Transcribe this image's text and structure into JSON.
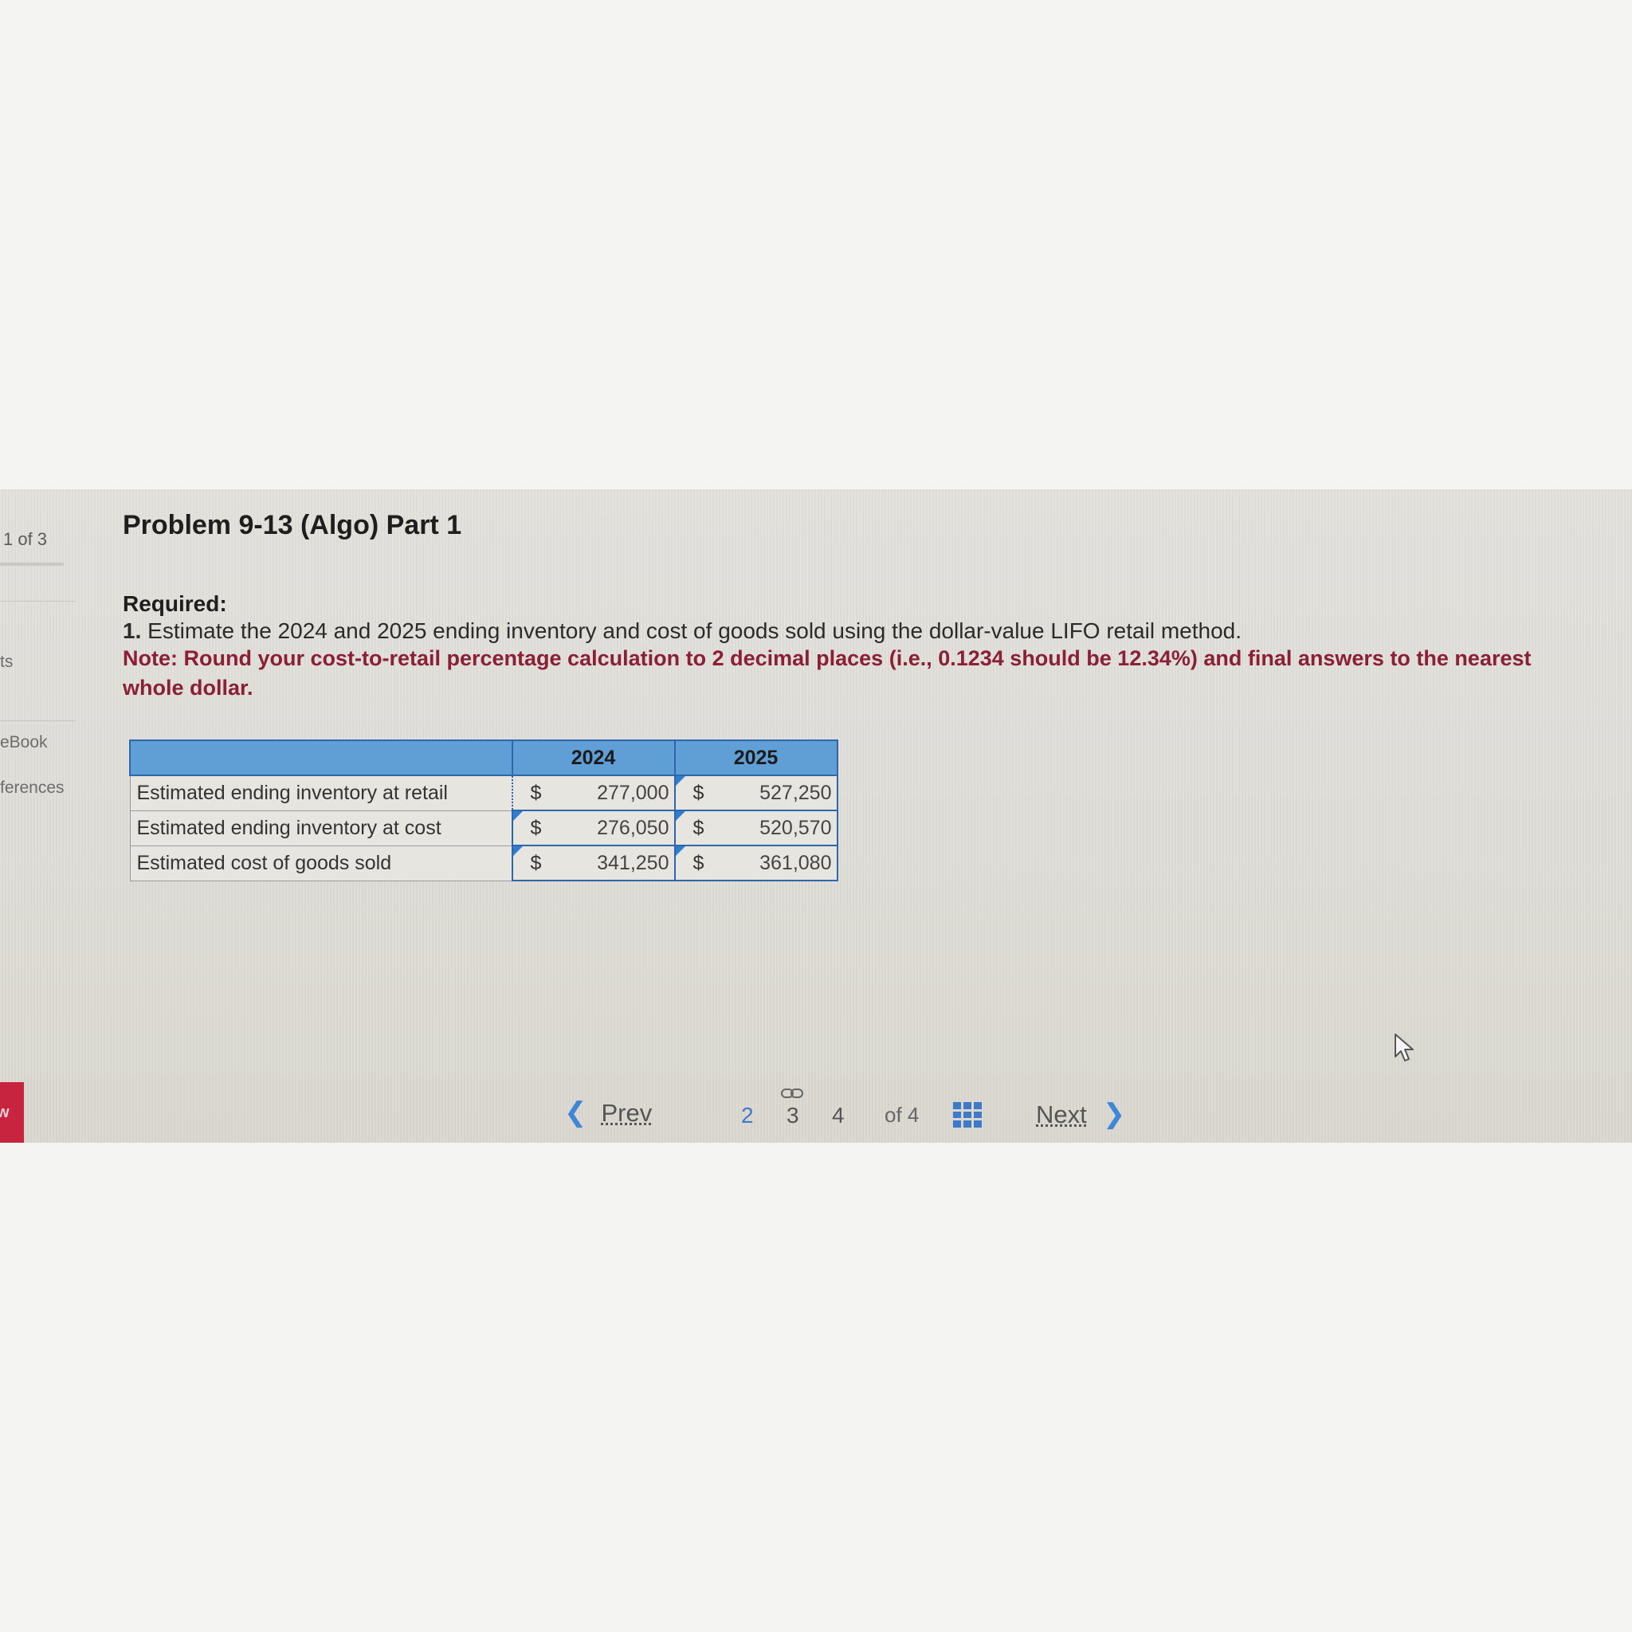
{
  "sidebar": {
    "counter": "1 of 3",
    "items": [
      {
        "label": "ts"
      },
      {
        "label": "eBook"
      },
      {
        "label": "ferences"
      }
    ],
    "button_label": "w"
  },
  "problem": {
    "title": "Problem 9-13 (Algo) Part 1",
    "required_label": "Required:",
    "requirement_number": "1.",
    "requirement_text": " Estimate the 2024 and 2025 ending inventory and cost of goods sold using the dollar-value LIFO retail method.",
    "note": "Note: Round your cost-to-retail percentage calculation to 2 decimal places (i.e., 0.1234 should be 12.34%) and final answers to the nearest whole dollar."
  },
  "table": {
    "headers": [
      "",
      "2024",
      "2025"
    ],
    "currency": "$",
    "rows": [
      {
        "label": "Estimated ending inventory at retail",
        "y2024": "277,000",
        "y2025": "527,250"
      },
      {
        "label": "Estimated ending inventory at cost",
        "y2024": "276,050",
        "y2025": "520,570"
      },
      {
        "label": "Estimated cost of goods sold",
        "y2024": "341,250",
        "y2025": "361,080"
      }
    ]
  },
  "pagination": {
    "prev_label": "Prev",
    "prev_icon": "chevron-left-icon",
    "pages": [
      "2",
      "3",
      "4"
    ],
    "of_label": "of 4",
    "next_label": "Next",
    "next_icon": "chevron-right-icon",
    "grid_icon": "grid-icon",
    "link_icon": "link-icon"
  },
  "colors": {
    "header_blue": "#5f9fd6",
    "border_blue": "#2f66a9",
    "note_red": "#8b1f35",
    "accent_red": "#c7253f"
  }
}
